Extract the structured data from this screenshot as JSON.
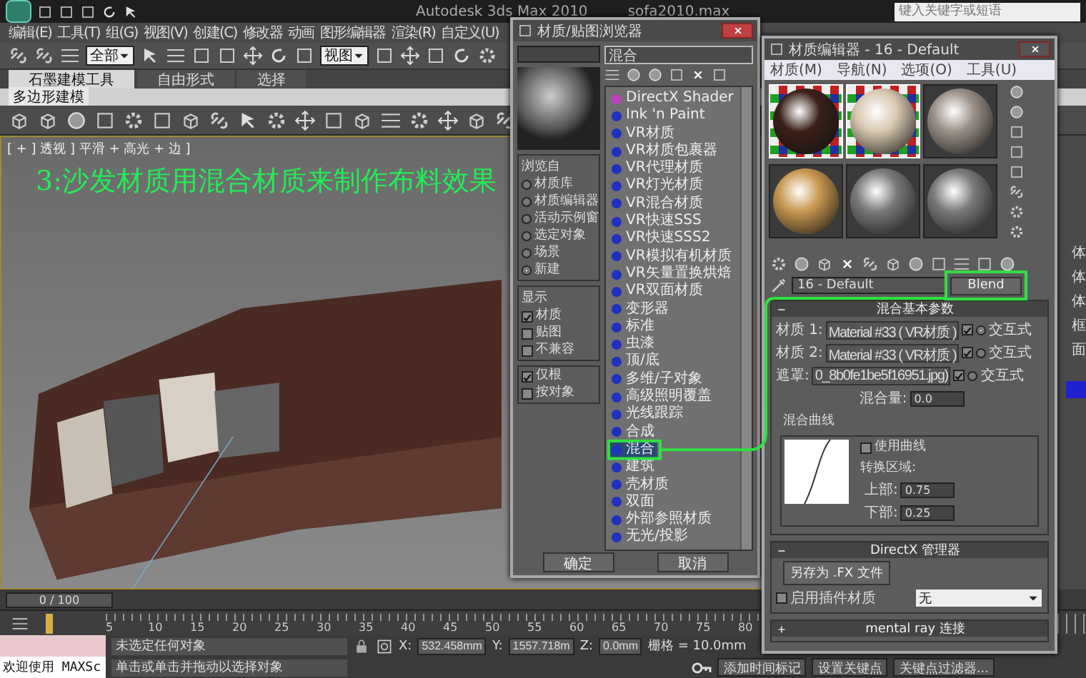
{
  "app": {
    "title": "Autodesk 3ds Max 2010",
    "file": "sofa2010.max",
    "search_placeholder": "键入关键字或短语"
  },
  "menu": [
    "编辑(E)",
    "工具(T)",
    "组(G)",
    "视图(V)",
    "创建(C)",
    "修改器",
    "动画",
    "图形编辑器",
    "渲染(R)",
    "自定义(U)"
  ],
  "toolbar": {
    "selection_filter": "全部",
    "reference_coord": "视图"
  },
  "ribbon": {
    "tabs": [
      {
        "label": "石墨建模工具",
        "selected": true
      },
      {
        "label": "自由形式",
        "selected": false
      },
      {
        "label": "选择",
        "selected": false
      }
    ],
    "panel": "多边形建模"
  },
  "viewport": {
    "label": "[ + ] 透视 ] 平滑 + 高光 + 边 ]",
    "caption": "3:沙发材质用混合材质来制作布料效果"
  },
  "command_panel": {
    "items": [
      "体",
      "体",
      "体",
      "框",
      "面"
    ]
  },
  "browser": {
    "title": "材质/贴图浏览器",
    "search": "混合",
    "browse_from": {
      "legend": "浏览自",
      "options": [
        {
          "label": "材质库",
          "selected": false
        },
        {
          "label": "材质编辑器",
          "selected": false
        },
        {
          "label": "活动示例窗",
          "selected": false
        },
        {
          "label": "选定对象",
          "selected": false
        },
        {
          "label": "场景",
          "selected": false
        },
        {
          "label": "新建",
          "selected": true
        }
      ]
    },
    "show": {
      "legend": "显示",
      "options": [
        {
          "label": "材质",
          "checked": true
        },
        {
          "label": "贴图",
          "checked": false
        },
        {
          "label": "不兼容",
          "checked": false
        }
      ]
    },
    "filters": [
      {
        "label": "仅根",
        "checked": true
      },
      {
        "label": "按对象",
        "checked": false
      }
    ],
    "items": [
      {
        "label": "DirectX Shader",
        "color": "#c040c0",
        "selected": false
      },
      {
        "label": "Ink 'n Paint",
        "color": "#2030c0",
        "selected": false
      },
      {
        "label": "VR材质",
        "color": "#2030c0",
        "selected": false
      },
      {
        "label": "VR材质包裹器",
        "color": "#2030c0",
        "selected": false
      },
      {
        "label": "VR代理材质",
        "color": "#2030c0",
        "selected": false
      },
      {
        "label": "VR灯光材质",
        "color": "#2030c0",
        "selected": false
      },
      {
        "label": "VR混合材质",
        "color": "#2030c0",
        "selected": false
      },
      {
        "label": "VR快速SSS",
        "color": "#2030c0",
        "selected": false
      },
      {
        "label": "VR快速SSS2",
        "color": "#2030c0",
        "selected": false
      },
      {
        "label": "VR模拟有机材质",
        "color": "#2030c0",
        "selected": false
      },
      {
        "label": "VR矢量置换烘焙",
        "color": "#2030c0",
        "selected": false
      },
      {
        "label": "VR双面材质",
        "color": "#2030c0",
        "selected": false
      },
      {
        "label": "变形器",
        "color": "#2030c0",
        "selected": false
      },
      {
        "label": "标准",
        "color": "#2030c0",
        "selected": false
      },
      {
        "label": "虫漆",
        "color": "#2030c0",
        "selected": false
      },
      {
        "label": "顶/底",
        "color": "#2030c0",
        "selected": false
      },
      {
        "label": "多维/子对象",
        "color": "#2030c0",
        "selected": false
      },
      {
        "label": "高级照明覆盖",
        "color": "#2030c0",
        "selected": false
      },
      {
        "label": "光线跟踪",
        "color": "#2030c0",
        "selected": false
      },
      {
        "label": "合成",
        "color": "#2030c0",
        "selected": false
      },
      {
        "label": "混合",
        "color": "#2030c0",
        "selected": true
      },
      {
        "label": "建筑",
        "color": "#2030c0",
        "selected": false
      },
      {
        "label": "壳材质",
        "color": "#2030c0",
        "selected": false
      },
      {
        "label": "双面",
        "color": "#2030c0",
        "selected": false
      },
      {
        "label": "外部参照材质",
        "color": "#2030c0",
        "selected": false
      },
      {
        "label": "无光/投影",
        "color": "#2030c0",
        "selected": false
      }
    ],
    "buttons": [
      "确定",
      "取消"
    ]
  },
  "editor": {
    "title": "材质编辑器 - 16 - Default",
    "menu": [
      "材质(M)",
      "导航(N)",
      "选项(O)",
      "工具(U)"
    ],
    "samples": [
      {
        "kind": "checker",
        "color": "#3a2018"
      },
      {
        "kind": "checker",
        "color": "#d8c8b0"
      },
      {
        "kind": "plain",
        "color": "#9a9088"
      },
      {
        "kind": "plain",
        "color": "#c89850"
      },
      {
        "kind": "plain",
        "color": "#7a7a7a"
      },
      {
        "kind": "plain",
        "color": "#7a7a7a"
      }
    ],
    "material_name": "16 - Default",
    "material_type": "Blend",
    "rollouts": [
      {
        "kind": "blend",
        "title": "混合基本参数",
        "expanded": true,
        "slots": [
          {
            "label": "材质 1:",
            "value": "Material #33 ( VR材质 )",
            "checked": true,
            "interactive": true,
            "radio_label": "交互式"
          },
          {
            "label": "材质 2:",
            "value": "Material #33 ( VR材质 )",
            "checked": true,
            "interactive": false,
            "radio_label": "交互式"
          },
          {
            "label": "遮罩:",
            "value": "0_8b0fe1be5f16951.jpg)",
            "checked": true,
            "interactive": false,
            "radio_label": "交互式"
          }
        ],
        "mix_label": "混合量:",
        "mix_value": "0.0",
        "curve": {
          "legend": "混合曲线",
          "use_curve": {
            "label": "使用曲线",
            "checked": false
          },
          "zone_label": "转换区域:",
          "upper_label": "上部:",
          "upper": "0.75",
          "lower_label": "下部:",
          "lower": "0.25"
        }
      },
      {
        "kind": "directx",
        "title": "DirectX 管理器",
        "expanded": true,
        "button": "另存为 .FX 文件",
        "plugin": {
          "label": "启用插件材质",
          "checked": false
        },
        "dropdown": "无"
      },
      {
        "kind": "plain",
        "title": "mental ray 连接",
        "expanded": false
      }
    ]
  },
  "timeline": {
    "frame": "0 / 100",
    "ticks": [
      "5",
      "10",
      "15",
      "20",
      "25",
      "30",
      "35",
      "40",
      "45",
      "50",
      "55",
      "60",
      "65",
      "70",
      "75",
      "80"
    ]
  },
  "status": {
    "welcome": "欢迎使用 MAXSc",
    "selection": "未选定任何对象",
    "prompt": "单击或单击并拖动以选择对象",
    "x_label": "X:",
    "x": "532.458mm",
    "y_label": "Y:",
    "y": "1557.718m",
    "z_label": "Z:",
    "z": "0.0mm",
    "grid": "栅格 = 10.0mm",
    "add_tag": "添加时间标记",
    "set_key": "设置关键点",
    "key_filters": "关键点过滤器..."
  }
}
